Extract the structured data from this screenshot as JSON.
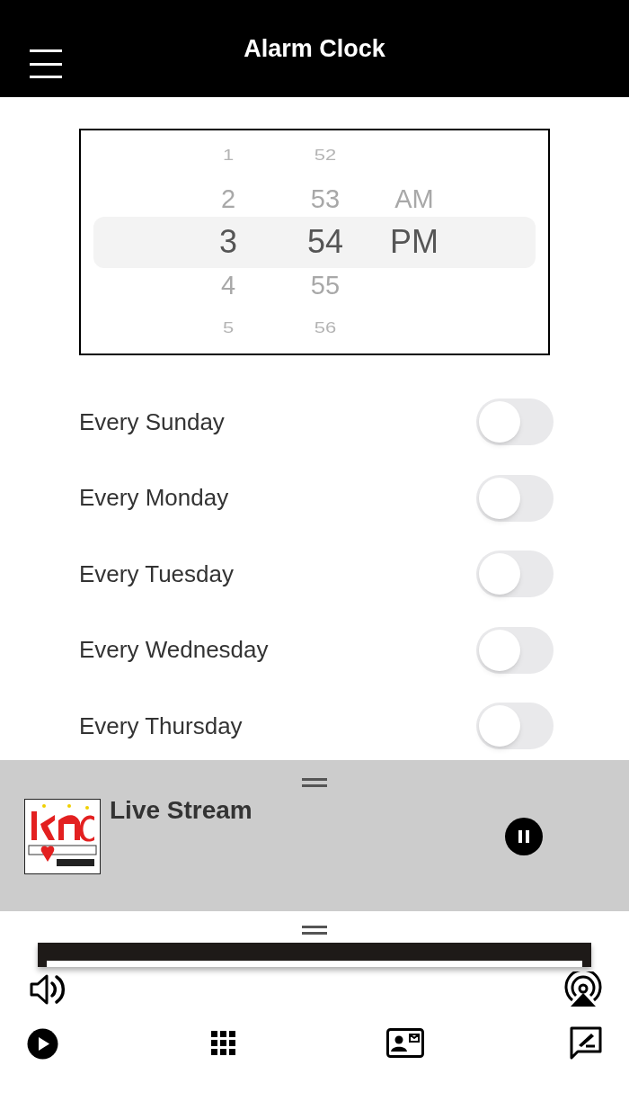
{
  "header": {
    "title": "Alarm Clock"
  },
  "picker": {
    "columns": [
      {
        "items": [
          {
            "label": "1",
            "selected": false
          },
          {
            "label": "2",
            "selected": false
          },
          {
            "label": "3",
            "selected": true
          },
          {
            "label": "4",
            "selected": false
          },
          {
            "label": "5",
            "selected": false
          }
        ]
      },
      {
        "items": [
          {
            "label": "52",
            "selected": false
          },
          {
            "label": "53",
            "selected": false
          },
          {
            "label": "54",
            "selected": true
          },
          {
            "label": "55",
            "selected": false
          },
          {
            "label": "56",
            "selected": false
          }
        ]
      },
      {
        "items": [
          {
            "label": "AM",
            "selected": false
          },
          {
            "label": "PM",
            "selected": true
          }
        ]
      }
    ]
  },
  "days": [
    {
      "label": "Every Sunday",
      "on": false
    },
    {
      "label": "Every Monday",
      "on": false
    },
    {
      "label": "Every Tuesday",
      "on": false
    },
    {
      "label": "Every Wednesday",
      "on": false
    },
    {
      "label": "Every Thursday",
      "on": false
    }
  ],
  "player": {
    "title": "Live Stream",
    "playing": true
  }
}
